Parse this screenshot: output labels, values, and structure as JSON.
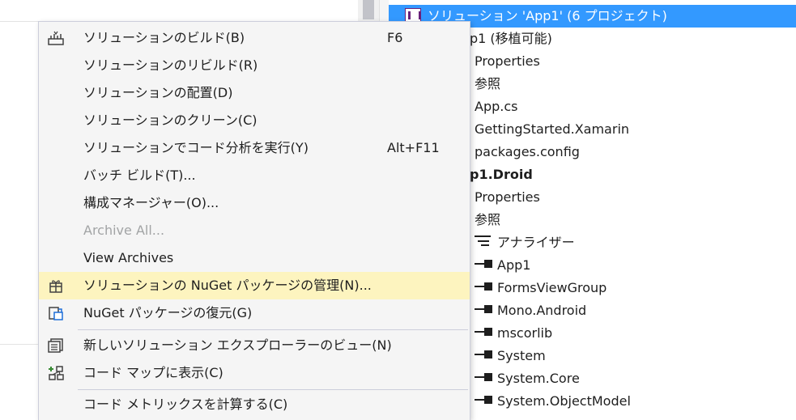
{
  "explorer": {
    "solution_label": "ソリューション 'App1' (6 プロジェクト)",
    "rows": [
      {
        "text": "p1 (移植可能)"
      },
      {
        "text": "Properties"
      },
      {
        "text": "参照"
      },
      {
        "text": "App.cs"
      },
      {
        "text": "GettingStarted.Xamarin"
      },
      {
        "text": "packages.config"
      },
      {
        "text": "p1.Droid"
      },
      {
        "text": "Properties"
      },
      {
        "text": "参照"
      },
      {
        "text": "アナライザー"
      },
      {
        "text": "App1"
      },
      {
        "text": "FormsViewGroup"
      },
      {
        "text": "Mono.Android"
      },
      {
        "text": "mscorlib"
      },
      {
        "text": "System"
      },
      {
        "text": "System.Core"
      },
      {
        "text": "System.ObjectModel"
      }
    ]
  },
  "menu": {
    "items": [
      {
        "label": "ソリューションのビルド(B)",
        "shortcut": "F6",
        "icon": "build-icon"
      },
      {
        "label": "ソリューションのリビルド(R)",
        "shortcut": ""
      },
      {
        "label": "ソリューションの配置(D)",
        "shortcut": ""
      },
      {
        "label": "ソリューションのクリーン(C)",
        "shortcut": ""
      },
      {
        "label": "ソリューションでコード分析を実行(Y)",
        "shortcut": "Alt+F11"
      },
      {
        "label": "バッチ ビルド(T)...",
        "shortcut": ""
      },
      {
        "label": "構成マネージャー(O)...",
        "shortcut": ""
      },
      {
        "label": "Archive All...",
        "shortcut": "",
        "disabled": true
      },
      {
        "label": "View Archives",
        "shortcut": ""
      },
      {
        "label": "ソリューションの NuGet パッケージの管理(N)...",
        "shortcut": "",
        "icon": "nuget-package-icon",
        "highlighted": true
      },
      {
        "label": "NuGet パッケージの復元(G)",
        "shortcut": "",
        "icon": "restore-package-icon"
      },
      {
        "label": "新しいソリューション エクスプローラーのビュー(N)",
        "shortcut": "",
        "icon": "new-explorer-view-icon"
      },
      {
        "label": "コード マップに表示(C)",
        "shortcut": "",
        "icon": "code-map-icon"
      },
      {
        "label": "コード メトリックスを計算する(C)",
        "shortcut": ""
      }
    ]
  },
  "colors": {
    "selection": "#3399ff",
    "highlight": "#fdf4bf",
    "menu_bg": "#f5f5f5",
    "disabled_text": "#a2a4a5"
  }
}
